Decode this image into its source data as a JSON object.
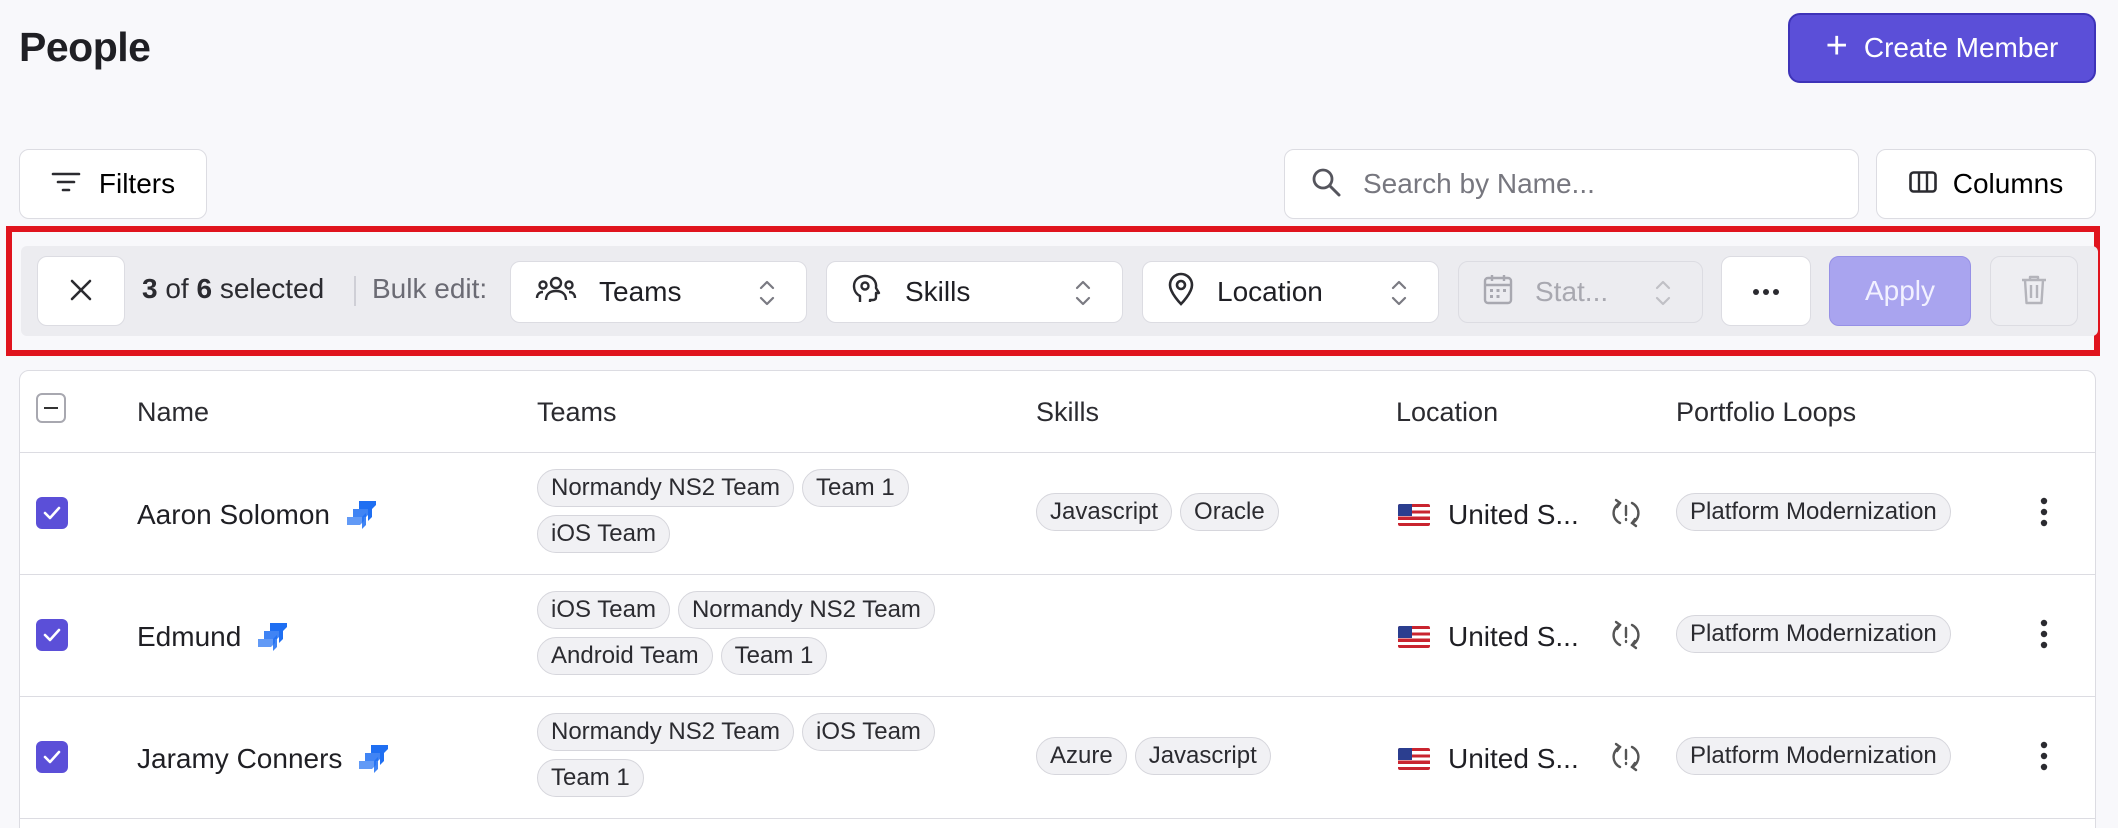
{
  "header": {
    "title": "People",
    "create_label": "Create Member"
  },
  "toolbar": {
    "filters_label": "Filters",
    "search_placeholder": "Search by Name...",
    "columns_label": "Columns"
  },
  "bulk_bar": {
    "selected_count": "3",
    "of_text": "of",
    "total_count": "6",
    "selected_text": "selected",
    "bulk_edit_label": "Bulk edit:",
    "teams_label": "Teams",
    "skills_label": "Skills",
    "location_label": "Location",
    "status_label": "Stat...",
    "apply_label": "Apply"
  },
  "table": {
    "columns": [
      "Name",
      "Teams",
      "Skills",
      "Location",
      "Portfolio Loops"
    ],
    "rows": [
      {
        "name": "Aaron Solomon",
        "teams": [
          "Normandy NS2 Team",
          "Team 1",
          "iOS Team"
        ],
        "skills": [
          "Javascript",
          "Oracle"
        ],
        "location": "United S...",
        "loops": [
          "Platform Modernization"
        ]
      },
      {
        "name": "Edmund",
        "teams": [
          "iOS Team",
          "Normandy NS2 Team",
          "Android Team",
          "Team 1"
        ],
        "skills": [],
        "location": "United S...",
        "loops": [
          "Platform Modernization"
        ]
      },
      {
        "name": "Jaramy Conners",
        "teams": [
          "Normandy NS2 Team",
          "iOS Team",
          "Team 1"
        ],
        "skills": [
          "Azure",
          "Javascript"
        ],
        "location": "United S...",
        "loops": [
          "Platform Modernization"
        ]
      }
    ]
  },
  "colors": {
    "accent": "#5b4fd8",
    "highlight": "#e0141e",
    "jira_blue": "#1f6ff2"
  }
}
